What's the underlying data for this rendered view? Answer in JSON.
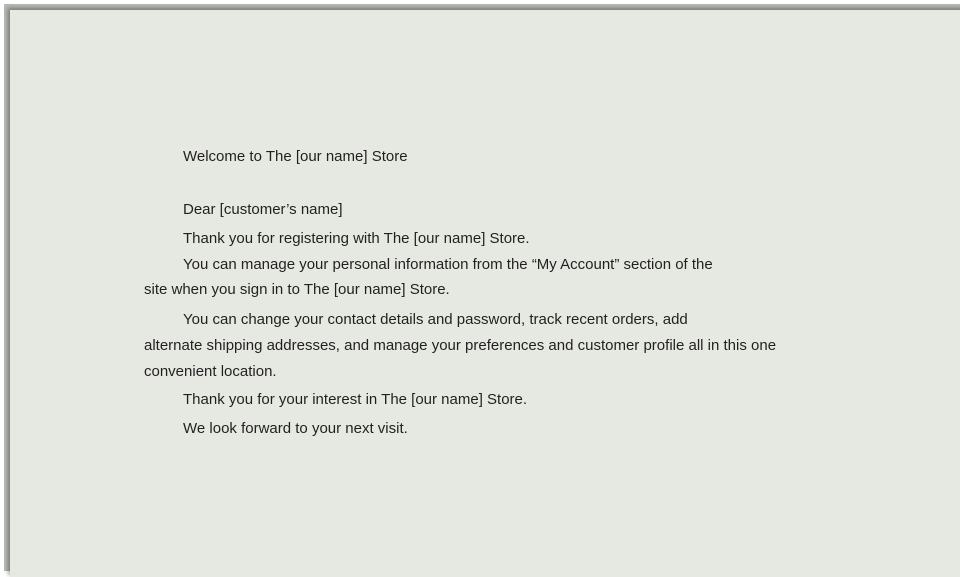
{
  "letter": {
    "heading": "Welcome to The [our name] Store",
    "salutation": "Dear [customer’s name]",
    "p1": "Thank you for registering with The [our name] Store.",
    "p2_line1": "You can manage your personal information from the “My Account” section of the",
    "p2_line2": "site when you sign in to The [our name] Store.",
    "p3_line1": "You can change your contact details and password, track recent orders, add",
    "p3_line2": "alternate shipping addresses, and manage your preferences and customer profile all in this one",
    "p3_line3": "convenient location.",
    "p4": "Thank you for your interest in The [our name] Store.",
    "p5": "We look forward to your next visit."
  }
}
